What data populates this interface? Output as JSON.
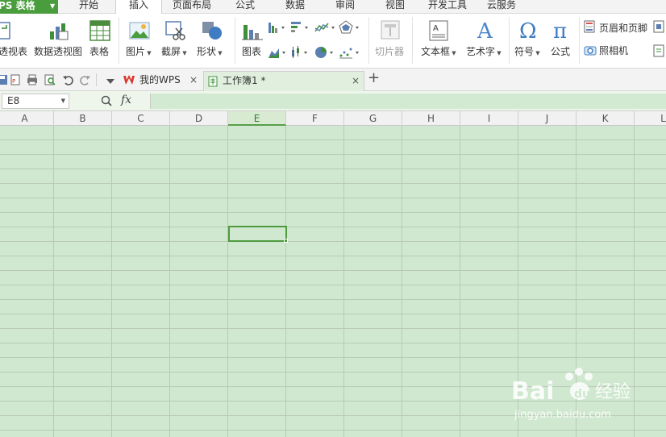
{
  "menu": {
    "app_title": "PS 表格",
    "tabs": [
      "开始",
      "插入",
      "页面布局",
      "公式",
      "数据",
      "审阅",
      "视图",
      "开发工具",
      "云服务"
    ],
    "active_tab": "插入"
  },
  "ribbon": {
    "pivot_table": "透视表",
    "pivot_chart": "数据透视图",
    "table": "表格",
    "picture": "图片",
    "screenshot": "截屏",
    "shape": "形状",
    "chart": "图表",
    "slicer": "切片器",
    "textbox": "文本框",
    "wordart": "艺术字",
    "symbol": "符号",
    "equation": "公式",
    "header_footer": "页眉和页脚",
    "camera": "照相机"
  },
  "doc_tabs": {
    "my_wps": "我的WPS",
    "workbook": "工作簿1 *",
    "close_glyph": "×",
    "new_tab_glyph": "+"
  },
  "formula_bar": {
    "cell_ref": "E8",
    "fx": "fx"
  },
  "grid": {
    "columns": [
      "A",
      "B",
      "C",
      "D",
      "E",
      "F",
      "G",
      "H",
      "I",
      "J",
      "K",
      "L"
    ],
    "active_column": "E",
    "colors": {
      "cell_bg": "#cfe8cf",
      "grid_line": "#b9c9b7",
      "selection": "#4f9a3f"
    }
  },
  "watermark": {
    "brand": "Bai",
    "brand_tail": "经验",
    "url": "jingyan.baidu.com"
  }
}
